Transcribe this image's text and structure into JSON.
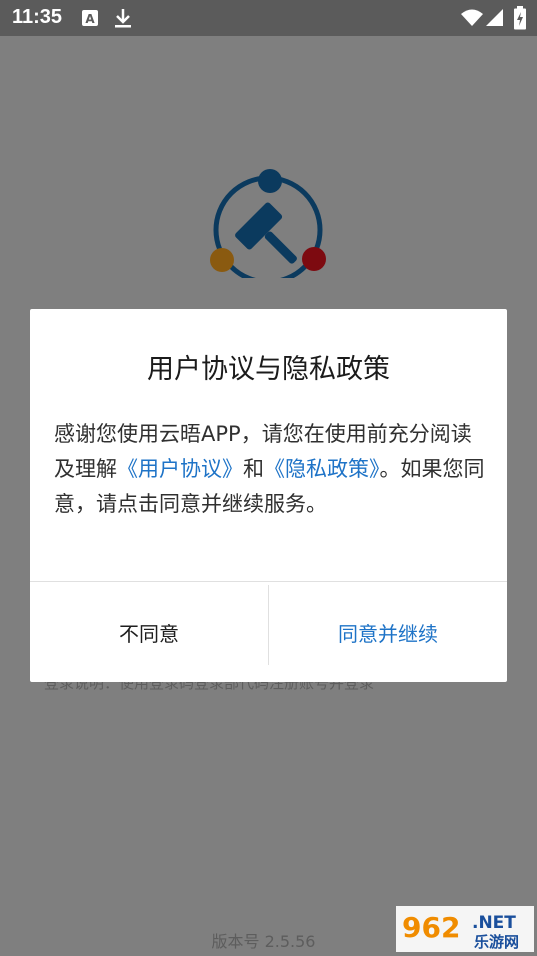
{
  "status_bar": {
    "time": "11:35",
    "icons": [
      "notification-a-icon",
      "download-icon",
      "wifi-icon",
      "signal-icon",
      "battery-icon"
    ]
  },
  "background": {
    "hint": "登录说明：使用登录码登录部代码注册账号并登录",
    "version": "版本号 2.5.56"
  },
  "dialog": {
    "title": "用户协议与隐私政策",
    "body_part1": "感谢您使用云晤APP，请您在使用前充分阅读及理解",
    "link_user_agreement": "《用户协议》",
    "body_and": "和",
    "link_privacy_policy": "《隐私政策》",
    "body_part2": "。如果您同意，请点击同意并继续服务。",
    "button_disagree": "不同意",
    "button_agree": "同意并继续"
  },
  "watermark": {
    "number": "962",
    "suffix": ".NET",
    "name": "乐游网"
  },
  "colors": {
    "overlay": "#7f7f7f",
    "status_bar": "#5b5b5b",
    "link": "#1e73c7",
    "logo_ring": "#0b3a5e",
    "logo_left_dot": "#8a5a10",
    "logo_right_dot": "#7d0a10"
  }
}
